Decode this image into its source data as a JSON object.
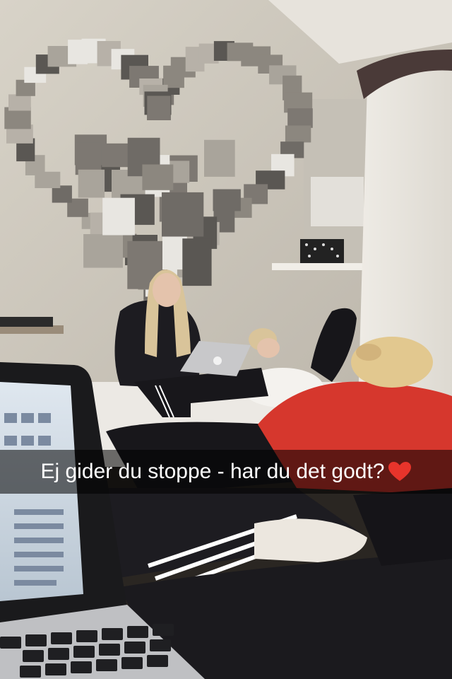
{
  "caption": {
    "text": "Ej gider du stoppe - har du det godt?",
    "emoji": "heart-icon",
    "emoji_color": "#e8342b"
  },
  "colors": {
    "wall": "#d9d4c9",
    "bedsheet": "#ece9e4",
    "red_top": "#d6372d",
    "black_clothing": "#1b1a1e"
  }
}
